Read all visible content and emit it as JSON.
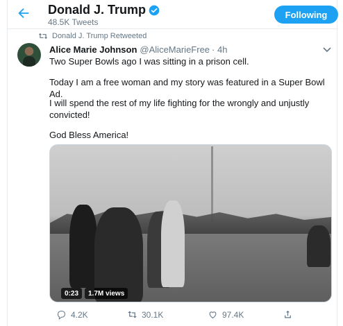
{
  "header": {
    "title": "Donald J. Trump",
    "subtitle": "48.5K Tweets",
    "follow_label": "Following",
    "back_icon": "back-arrow-icon",
    "verified_icon": "verified-badge-icon"
  },
  "retweet": {
    "label": "Donald J. Trump Retweeted"
  },
  "tweet": {
    "author_name": "Alice Marie Johnson",
    "handle": "@AliceMarieFree",
    "time": "· 4h",
    "paragraphs": [
      "Two Super Bowls ago I was sitting in a prison cell.",
      "Today I am a free woman and my story was featured in a Super Bowl Ad.",
      "I will spend the rest of my life fighting for the wrongly and unjustly convicted!",
      "God Bless America!"
    ],
    "media": {
      "duration": "0:23",
      "views": "1.7M views"
    },
    "actions": {
      "replies": "4.2K",
      "retweets": "30.1K",
      "likes": "97.4K"
    }
  },
  "colors": {
    "accent": "#1da1f2",
    "muted": "#657786",
    "text": "#14171a"
  }
}
